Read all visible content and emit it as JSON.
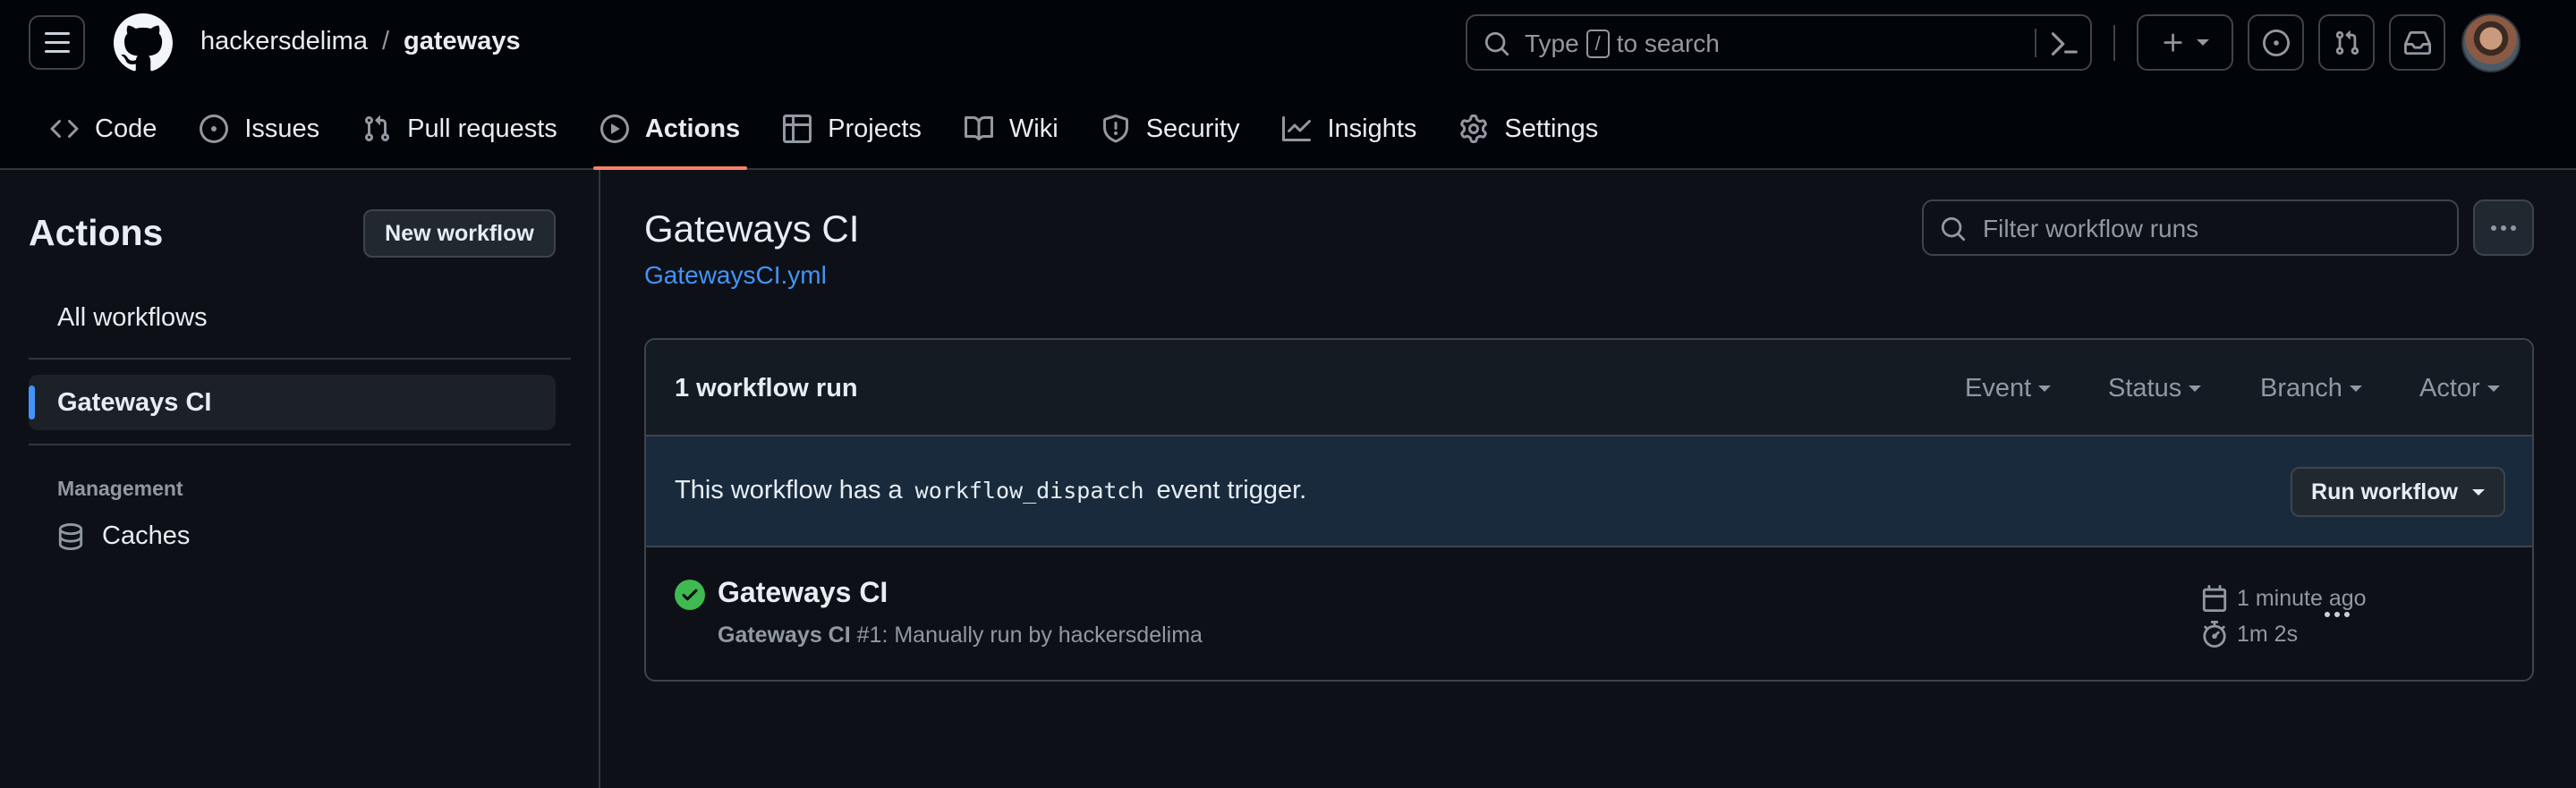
{
  "header": {
    "owner": "hackersdelima",
    "separator": "/",
    "repo": "gateways",
    "search_prefix": "Type",
    "search_key": "/",
    "search_suffix": "to search"
  },
  "tabs": [
    {
      "label": "Code",
      "icon": "code-icon"
    },
    {
      "label": "Issues",
      "icon": "issue-opened-icon"
    },
    {
      "label": "Pull requests",
      "icon": "git-pull-request-icon"
    },
    {
      "label": "Actions",
      "icon": "play-icon",
      "active": true
    },
    {
      "label": "Projects",
      "icon": "table-icon"
    },
    {
      "label": "Wiki",
      "icon": "book-icon"
    },
    {
      "label": "Security",
      "icon": "shield-icon"
    },
    {
      "label": "Insights",
      "icon": "graph-icon"
    },
    {
      "label": "Settings",
      "icon": "gear-icon"
    }
  ],
  "sidebar": {
    "title": "Actions",
    "new_workflow": "New workflow",
    "all_workflows": "All workflows",
    "selected_workflow": "Gateways CI",
    "management_heading": "Management",
    "caches": "Caches"
  },
  "main": {
    "title": "Gateways CI",
    "file_link": "GatewaysCI.yml",
    "filter_placeholder": "Filter workflow runs",
    "runs_count": "1 workflow run",
    "filters": [
      "Event",
      "Status",
      "Branch",
      "Actor"
    ],
    "dispatch_pre": "This workflow has a",
    "dispatch_code": "workflow_dispatch",
    "dispatch_post": "event trigger.",
    "run_workflow": "Run workflow",
    "run": {
      "title": "Gateways CI",
      "sub_bold": "Gateways CI",
      "sub_rest": "#1: Manually run by hackersdelima",
      "time": "1 minute ago",
      "duration": "1m 2s",
      "status": "success"
    }
  },
  "colors": {
    "accent": "#4493f8",
    "active_tab_underline": "#f78166",
    "success": "#3fb950"
  }
}
